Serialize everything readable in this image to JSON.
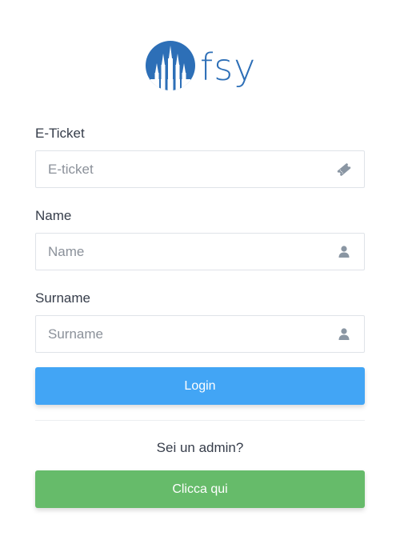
{
  "logo": {
    "text": "fsy",
    "icon": "cathedral-globe-logo",
    "color": "#2d6fb7"
  },
  "form": {
    "eticket": {
      "label": "E-Ticket",
      "placeholder": "E-ticket",
      "value": "",
      "icon": "ticket-icon"
    },
    "name": {
      "label": "Name",
      "placeholder": "Name",
      "value": "",
      "icon": "user-icon"
    },
    "surname": {
      "label": "Surname",
      "placeholder": "Surname",
      "value": "",
      "icon": "user-icon"
    }
  },
  "login_button": {
    "label": "Login",
    "color": "#42a5f5"
  },
  "admin": {
    "prompt": "Sei un admin?",
    "button_label": "Clicca qui",
    "button_color": "#66bb6a"
  },
  "colors": {
    "icon": "#8a96a3",
    "border": "#dfe3e8"
  }
}
